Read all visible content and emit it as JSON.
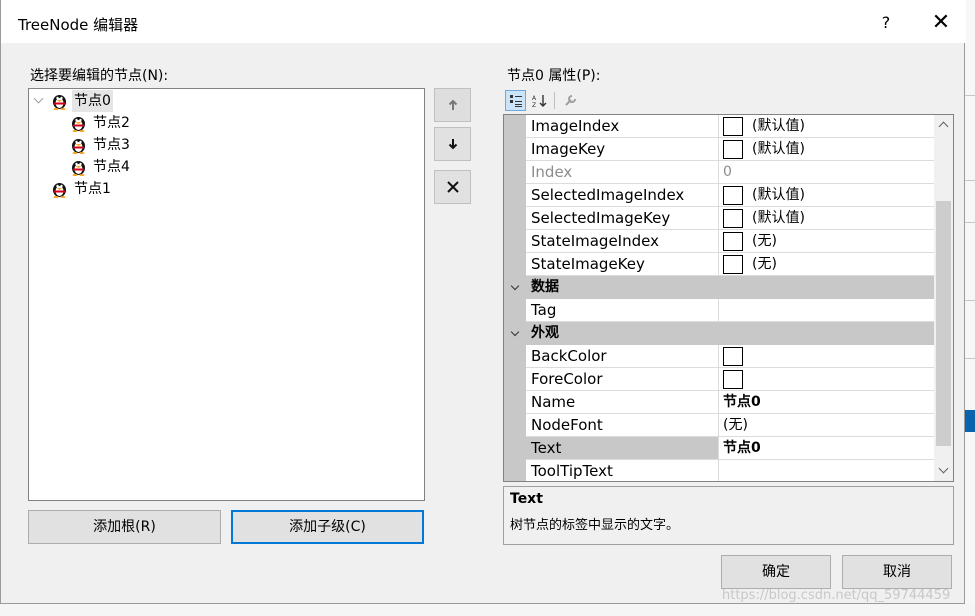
{
  "window": {
    "title": "TreeNode 编辑器",
    "help_glyph": "?",
    "close_glyph": "✕"
  },
  "left": {
    "label": "选择要编辑的节点(N):",
    "nodes": [
      {
        "label": "节点0",
        "level": 0,
        "expanded": true,
        "selected": true
      },
      {
        "label": "节点2",
        "level": 1
      },
      {
        "label": "节点3",
        "level": 1
      },
      {
        "label": "节点4",
        "level": 1
      },
      {
        "label": "节点1",
        "level": 0
      }
    ],
    "add_root_label": "添加根(R)",
    "add_child_label": "添加子级(C)"
  },
  "side_buttons": {
    "up_glyph": "↑",
    "down_glyph": "↓",
    "delete_glyph": "✕"
  },
  "properties": {
    "label": "节点0 属性(P):",
    "rows": [
      {
        "name": "ImageIndex",
        "value": "(默认值)",
        "swatch": true
      },
      {
        "name": "ImageKey",
        "value": "(默认值)",
        "swatch": true
      },
      {
        "name": "Index",
        "value": "0",
        "disabled": true
      },
      {
        "name": "SelectedImageIndex",
        "value": "(默认值)",
        "swatch": true
      },
      {
        "name": "SelectedImageKey",
        "value": "(默认值)",
        "swatch": true
      },
      {
        "name": "StateImageIndex",
        "value": "(无)",
        "swatch": true
      },
      {
        "name": "StateImageKey",
        "value": "(无)",
        "swatch": true
      },
      {
        "category": "数据"
      },
      {
        "name": "Tag",
        "value": ""
      },
      {
        "category": "外观"
      },
      {
        "name": "BackColor",
        "value": "",
        "swatch": true
      },
      {
        "name": "ForeColor",
        "value": "",
        "swatch": true
      },
      {
        "name": "Name",
        "value": "节点0",
        "bold": true
      },
      {
        "name": "NodeFont",
        "value": "(无)"
      },
      {
        "name": "Text",
        "value": "节点0",
        "bold": true,
        "selected": true
      },
      {
        "name": "ToolTipText",
        "value": ""
      }
    ],
    "help_title": "Text",
    "help_desc": "树节点的标签中显示的文字。"
  },
  "footer": {
    "ok_label": "确定",
    "cancel_label": "取消"
  },
  "watermark": "https://blog.csdn.net/qq_59744459"
}
